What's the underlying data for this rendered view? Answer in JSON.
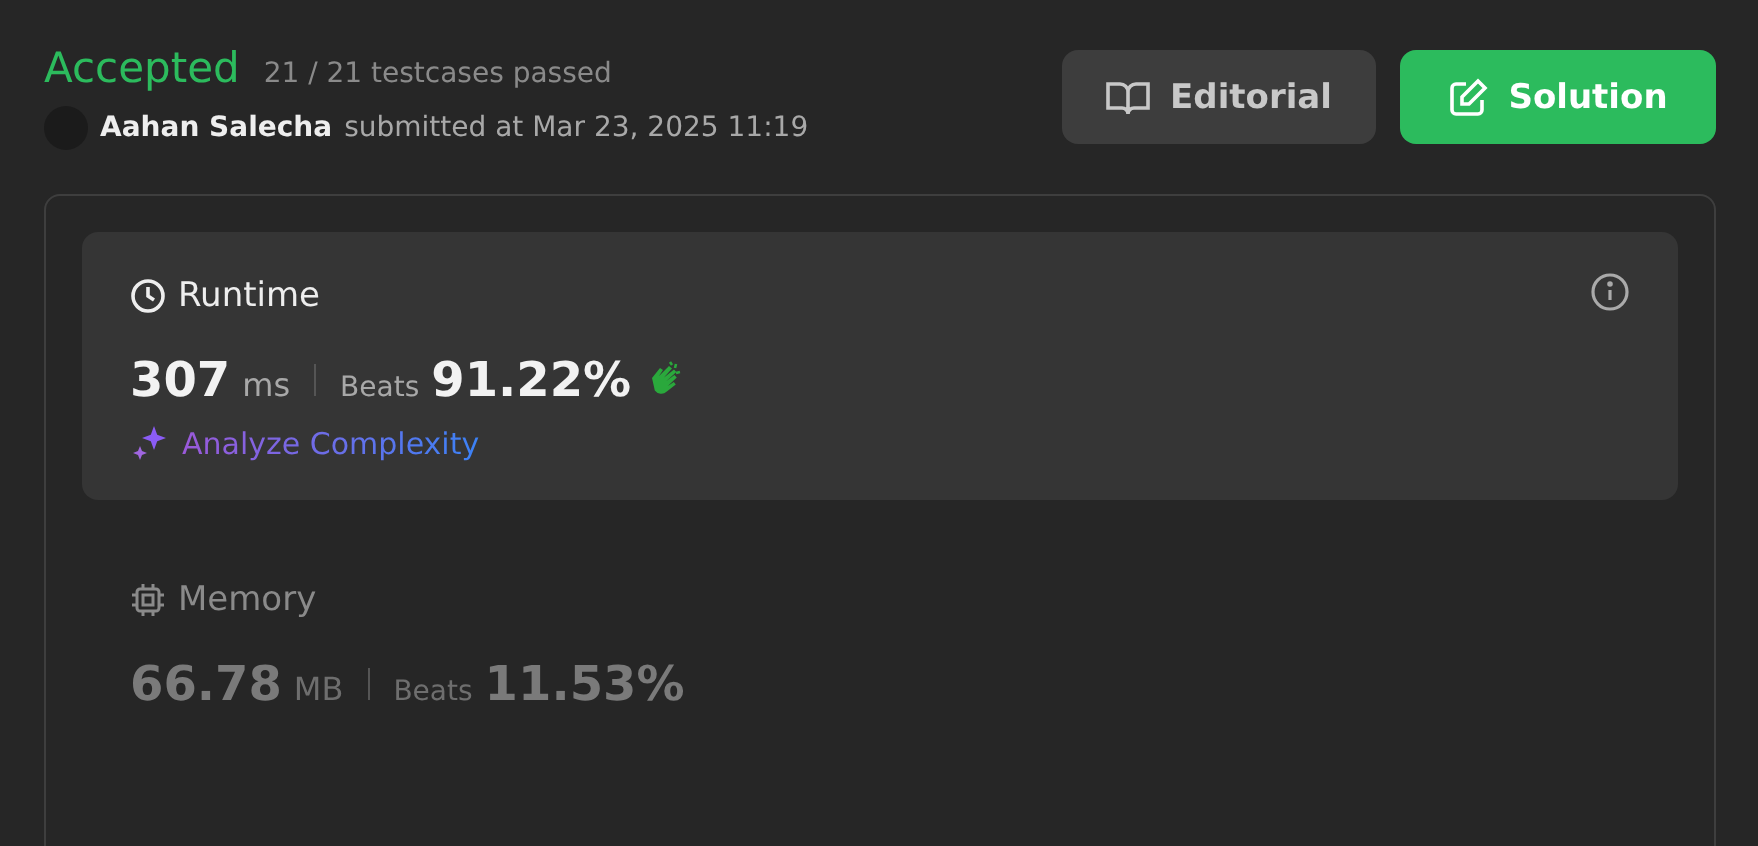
{
  "status": {
    "label": "Accepted",
    "detail": "21 / 21 testcases passed"
  },
  "submission": {
    "user": "Aahan Salecha",
    "text": "submitted at Mar 23, 2025 11:19"
  },
  "buttons": [
    {
      "label": "Editorial",
      "kind": "editorial"
    },
    {
      "label": "Solution",
      "kind": "solution"
    }
  ],
  "metrics": [
    {
      "title": "Runtime",
      "kind": "runtime",
      "selected": true,
      "value": "307",
      "unit": "ms",
      "beats_label": "Beats",
      "beats": "91.22%",
      "action": "Analyze Complexity"
    },
    {
      "title": "Memory",
      "kind": "memory",
      "selected": false,
      "value": "66.78",
      "unit": "MB",
      "beats_label": "Beats",
      "beats": "11.53%"
    }
  ]
}
